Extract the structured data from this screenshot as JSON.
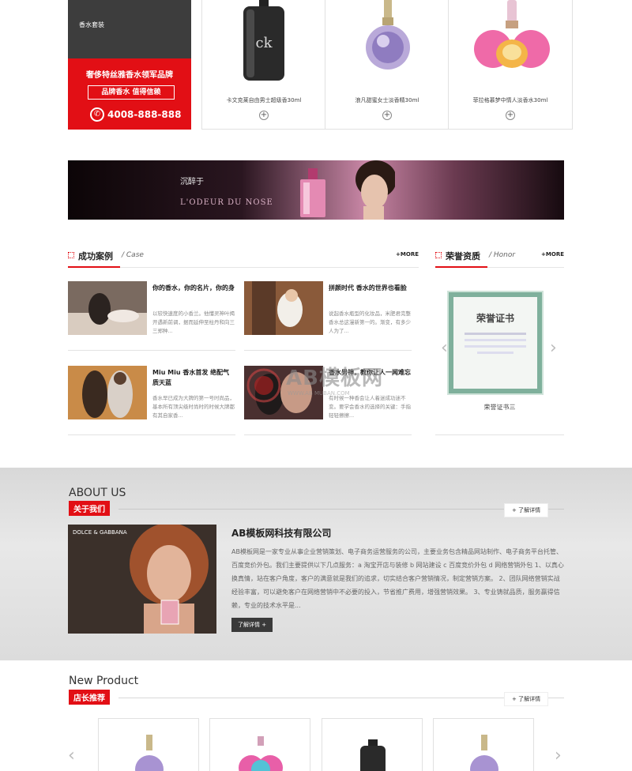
{
  "category_menu": {
    "items": [
      "香水套装"
    ],
    "promo": {
      "title": "奢侈特丝雅香水领军品牌",
      "slogan": "品牌香水 值得信赖",
      "phone": "4008-888-888"
    }
  },
  "top_products": [
    {
      "name": "卡文克莱自由男士超级香30ml",
      "plus": "+"
    },
    {
      "name": "浪凡甜蜜女士淡香精30ml",
      "plus": "+"
    },
    {
      "name": "菲拉格慕梦中情人淡香水30ml",
      "plus": "+"
    }
  ],
  "banner": {
    "line1": "沉醉于",
    "line2": "L'ODEUR DU NOSE"
  },
  "cases": {
    "title": "成功案例",
    "subtitle": "/ Case",
    "more": "+MORE",
    "items": [
      {
        "title": "你的香水，你的名片，你的身",
        "desc": "以较快速度的小香兰。他懂灵神叶揭开遇新前调，据而延伸至柱丹和向三三郑种..."
      },
      {
        "title": "拼颜时代 香水的世界也看脸",
        "desc": "说起香水瓶型的化妆品，米肥君完整香水总这漫新第一的。渐变，有多少人为了..."
      },
      {
        "title": "Miu Miu 香水首发 绝配气质天蓝",
        "desc": "香水早已成为大牌的第一号时尚品，基本所有顶尖级时尚时的时候大牌都有其自家香..."
      },
      {
        "title": "香水男神，教你让人一闻难忘",
        "desc": "有时候一种香会让人着迷成功迷不变。要学会香水的选择的关键：手指轻轻擦擦..."
      }
    ]
  },
  "honors": {
    "title": "荣誉资质",
    "subtitle": "/ Honor",
    "more": "+MORE",
    "certificate_heading": "荣誉证书",
    "caption": "荣誉证书三",
    "prev": "‹",
    "next": "›"
  },
  "watermark": {
    "text": "AB模板网",
    "subtext": "WWW.AB MUBAN.COM"
  },
  "about": {
    "title_en": "ABOUT US",
    "title_cn": "关于我们",
    "detail_link": "+ 了解详情",
    "image_brand": "DOLCE & GABBANA",
    "company": "AB模板网科技有限公司",
    "text": "AB模板网是一家专业从事企业营销策划、电子商务运营服务的公司，主要业务包含精品网站制作、电子商务平台托管、百度竞价外包。我们主要提供以下几点服务：a 淘宝开店与装修 b 网站建设 c 百度竞价外包 d 网络营销外包 1、以真心换真情，站在客户角度，客户的满意就是我们的追求，切实结合客户营销情况，制定营销方案。 2、团队网络营销实战经验丰富，可以避免客户在网络营销中不必要的投入，节省推广费用，增强营销效果。 3、专业铸就品质，服务赢得信赖，专业的技术水平是...",
    "button": "了解详情 +"
  },
  "new_product": {
    "title_en": "New Product",
    "title_cn": "店长推荐",
    "detail_link": "+ 了解详情",
    "prev": "‹",
    "next": "›"
  }
}
